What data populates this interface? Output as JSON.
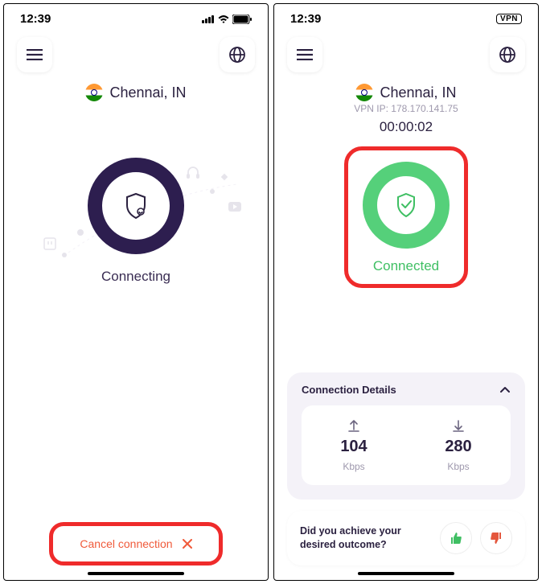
{
  "status_time": "12:39",
  "vpn_badge": "VPN",
  "left": {
    "location": "Chennai, IN",
    "status": "Connecting",
    "cancel": "Cancel connection"
  },
  "right": {
    "location": "Chennai, IN",
    "ip_label": "VPN IP: 178.170.141.75",
    "timer": "00:00:02",
    "status": "Connected",
    "details_title": "Connection Details",
    "up_val": "104",
    "up_unit": "Kbps",
    "down_val": "280",
    "down_unit": "Kbps",
    "outcome_q": "Did you achieve your desired outcome?"
  }
}
